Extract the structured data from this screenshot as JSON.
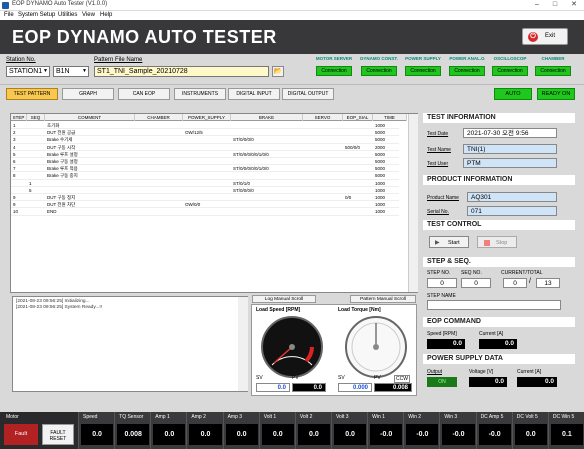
{
  "window": {
    "title": "EOP DYNAMO Auto Tester (V1.0.0)",
    "minimize": "–",
    "maximize": "□",
    "close": "✕"
  },
  "menu": [
    "File",
    "System Setup",
    "Utilities",
    "View",
    "Help"
  ],
  "header": {
    "title": "EOP DYNAMO AUTO TESTER",
    "exit_label": "Exit"
  },
  "setup": {
    "station_label": "Station No.",
    "station_value": "STATION1",
    "channel_value": "B1N",
    "pattern_label": "Pattern File Name",
    "pattern_value": "ST1_TNI_Sample_20210728",
    "connections": [
      {
        "label": "MOTOR SERVER",
        "button": "Connection"
      },
      {
        "label": "DYNAMO CONST.",
        "button": "Connection"
      },
      {
        "label": "POWER SUPPLY",
        "button": "Connection"
      },
      {
        "label": "POWER ANAL.G",
        "button": "Connection"
      },
      {
        "label": "OSCILLOSCOP",
        "button": "Connection"
      },
      {
        "label": "CHAMBER",
        "button": "Connection"
      }
    ]
  },
  "tabs": [
    "TEST PATTERN",
    "GRAPH",
    "CAN EOP",
    "INSTRUMENTS",
    "DIGITAL INPUT",
    "DIGITAL OUTPUT"
  ],
  "mode_buttons": {
    "auto": "AUTO",
    "ready": "READY ON"
  },
  "grid": {
    "headers": [
      "STEP",
      "SEQ",
      "COMMENT",
      "CHAMBER",
      "POWER_SUPPLY",
      "BRAKE",
      "SERVO",
      "EOP_SIAL",
      "TIME"
    ],
    "rows": [
      [
        "1",
        "",
        "초기화",
        "",
        "",
        "",
        "",
        "",
        "1000"
      ],
      [
        "2",
        "",
        "DUT 전원 공급",
        "",
        "OW/12/5",
        "",
        "",
        "",
        "5000"
      ],
      [
        "3",
        "",
        "Brake 수기세",
        "",
        "",
        "ST/0/0/0/0",
        "",
        "",
        "5000"
      ],
      [
        "4",
        "",
        "DUT 구동 시작",
        "",
        "",
        "",
        "",
        "500/0/0",
        "2000"
      ],
      [
        "5",
        "",
        "Brake 루프 설정",
        "",
        "",
        "ST/0/0/0/0/0/1/0/0",
        "",
        "",
        "5000"
      ],
      [
        "6",
        "",
        "Brake 구동 설정",
        "",
        "",
        "",
        "",
        "",
        "5000"
      ],
      [
        "7",
        "",
        "Brake 루프 적용",
        "",
        "",
        "ST/0/0/0/0/0/1/0/0",
        "",
        "",
        "5000"
      ],
      [
        "8",
        "",
        "Brake 구동 중지",
        "",
        "",
        "",
        "",
        "",
        "5000"
      ],
      [
        "",
        "1",
        "",
        "",
        "",
        "ST/0/1/0",
        "",
        "",
        "1000"
      ],
      [
        "",
        "5",
        "",
        "",
        "",
        "ST/0/0/0/0",
        "",
        "",
        "1000"
      ],
      [
        "9",
        "",
        "DUT 구동 정지",
        "",
        "",
        "",
        "",
        "0/0",
        "1000"
      ],
      [
        "9",
        "",
        "DUT 전원 차단",
        "",
        "OW/0/0",
        "",
        "",
        "",
        "1000"
      ],
      [
        "10",
        "",
        "END",
        "",
        "",
        "",
        "",
        "",
        "1000"
      ]
    ]
  },
  "log": {
    "lines": [
      "[2021-08-23 09:56:25] Initializing...",
      "[2021-08-23 09:56:25] System Ready...!!"
    ],
    "log_scroll": "Log Manual Scroll",
    "pattern_scroll": "Pattern Manual Scroll"
  },
  "gauges": {
    "speed": {
      "title": "Load Speed [RPM]",
      "sv_label": "SV",
      "pv_label": "PV",
      "sv": "0.0",
      "pv": "0.0",
      "level": 0
    },
    "torque": {
      "title": "Load Torque [Nm]",
      "sv_label": "SV",
      "pv_label": "PV",
      "ccw": "CCW",
      "sv": "0.000",
      "pv": "0.008",
      "level": 0
    }
  },
  "test_info": {
    "title": "TEST INFORMATION",
    "date_label": "Test Date",
    "date": "2021-07-30 오전 9:56",
    "name_label": "Test Name",
    "name": "TNI(1)",
    "user_label": "Test User",
    "user": "PTM"
  },
  "product_info": {
    "title": "PRODUCT INFORMATION",
    "name_label": "Product Name",
    "name": "AQ301",
    "serial_label": "Serial No.",
    "serial": "071"
  },
  "test_control": {
    "title": "TEST CONTROL",
    "start": "Start",
    "stop": "Stop"
  },
  "step_seq": {
    "title": "STEP & SEQ.",
    "step_label": "STEP NO.",
    "step": "0",
    "seq_label": "SEQ NO.",
    "seq": "0",
    "current_label": "CURRENT/TOTAL",
    "current": "0",
    "total": "13",
    "name_label": "STEP NAME",
    "name": ""
  },
  "eop_command": {
    "title": "EOP COMMAND",
    "speed_label": "Speed [RPM]",
    "speed": "0.0",
    "current_label": "Current [A]",
    "current": "0.0"
  },
  "power_supply": {
    "title": "POWER SUPPLY DATA",
    "output_label": "Output",
    "output_state": "ON",
    "voltage_label": "Voltage [V]",
    "voltage": "0.0",
    "current_label": "Current [A]",
    "current": "0.0"
  },
  "motor": {
    "label": "Motor",
    "fault": "Fault",
    "reset": "FAULT RESET"
  },
  "measurements": [
    {
      "label": "Speed",
      "value": "0.0"
    },
    {
      "label": "TQ Sensor",
      "value": "0.008"
    },
    {
      "label": "Amp 1",
      "value": "0.0"
    },
    {
      "label": "Amp 2",
      "value": "0.0"
    },
    {
      "label": "Amp 3",
      "value": "0.0"
    },
    {
      "label": "Volt 1",
      "value": "0.0"
    },
    {
      "label": "Volt 2",
      "value": "0.0"
    },
    {
      "label": "Volt 3",
      "value": "0.0"
    },
    {
      "label": "Win 1",
      "value": "-0.0"
    },
    {
      "label": "Win 2",
      "value": "-0.0"
    },
    {
      "label": "Win 3",
      "value": "-0.0"
    },
    {
      "label": "DC Amp 5",
      "value": "-0.0"
    },
    {
      "label": "DC Volt 5",
      "value": "0.0"
    },
    {
      "label": "DC Win 5",
      "value": "0.1"
    }
  ],
  "colors": {
    "header": "#38383a",
    "connection": "#22c51f",
    "tab_selected": "#f9c850",
    "panel": "#d9d9d9"
  }
}
